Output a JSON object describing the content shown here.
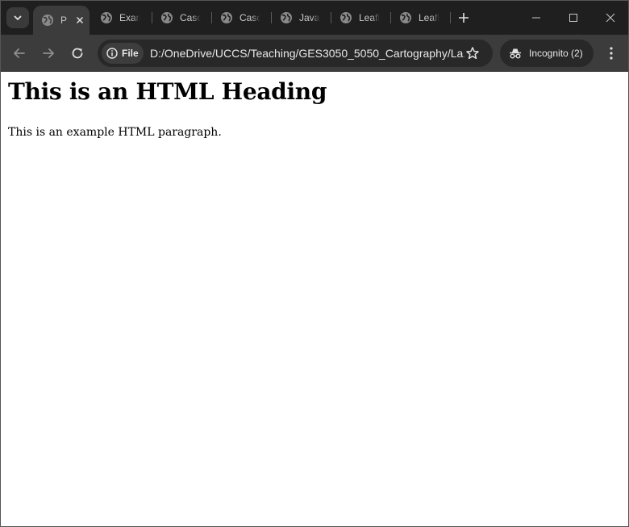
{
  "browser": {
    "tabs": [
      {
        "label": "P",
        "active": true
      },
      {
        "label": "Exam"
      },
      {
        "label": "Casca"
      },
      {
        "label": "Casca"
      },
      {
        "label": "JavaS"
      },
      {
        "label": "Leafle"
      },
      {
        "label": "Leafle"
      }
    ],
    "address": {
      "scheme_chip": "File",
      "url": "D:/OneDrive/UCCS/Teaching/GES3050_5050_Cartography/La..."
    },
    "profile": {
      "label": "Incognito (2)"
    },
    "colors": {
      "frame": "#1f1f1f",
      "toolbar": "#3c3c3c",
      "omnibox": "#282828"
    }
  },
  "page": {
    "heading": "This is an HTML Heading",
    "paragraph": "This is an example HTML paragraph."
  }
}
